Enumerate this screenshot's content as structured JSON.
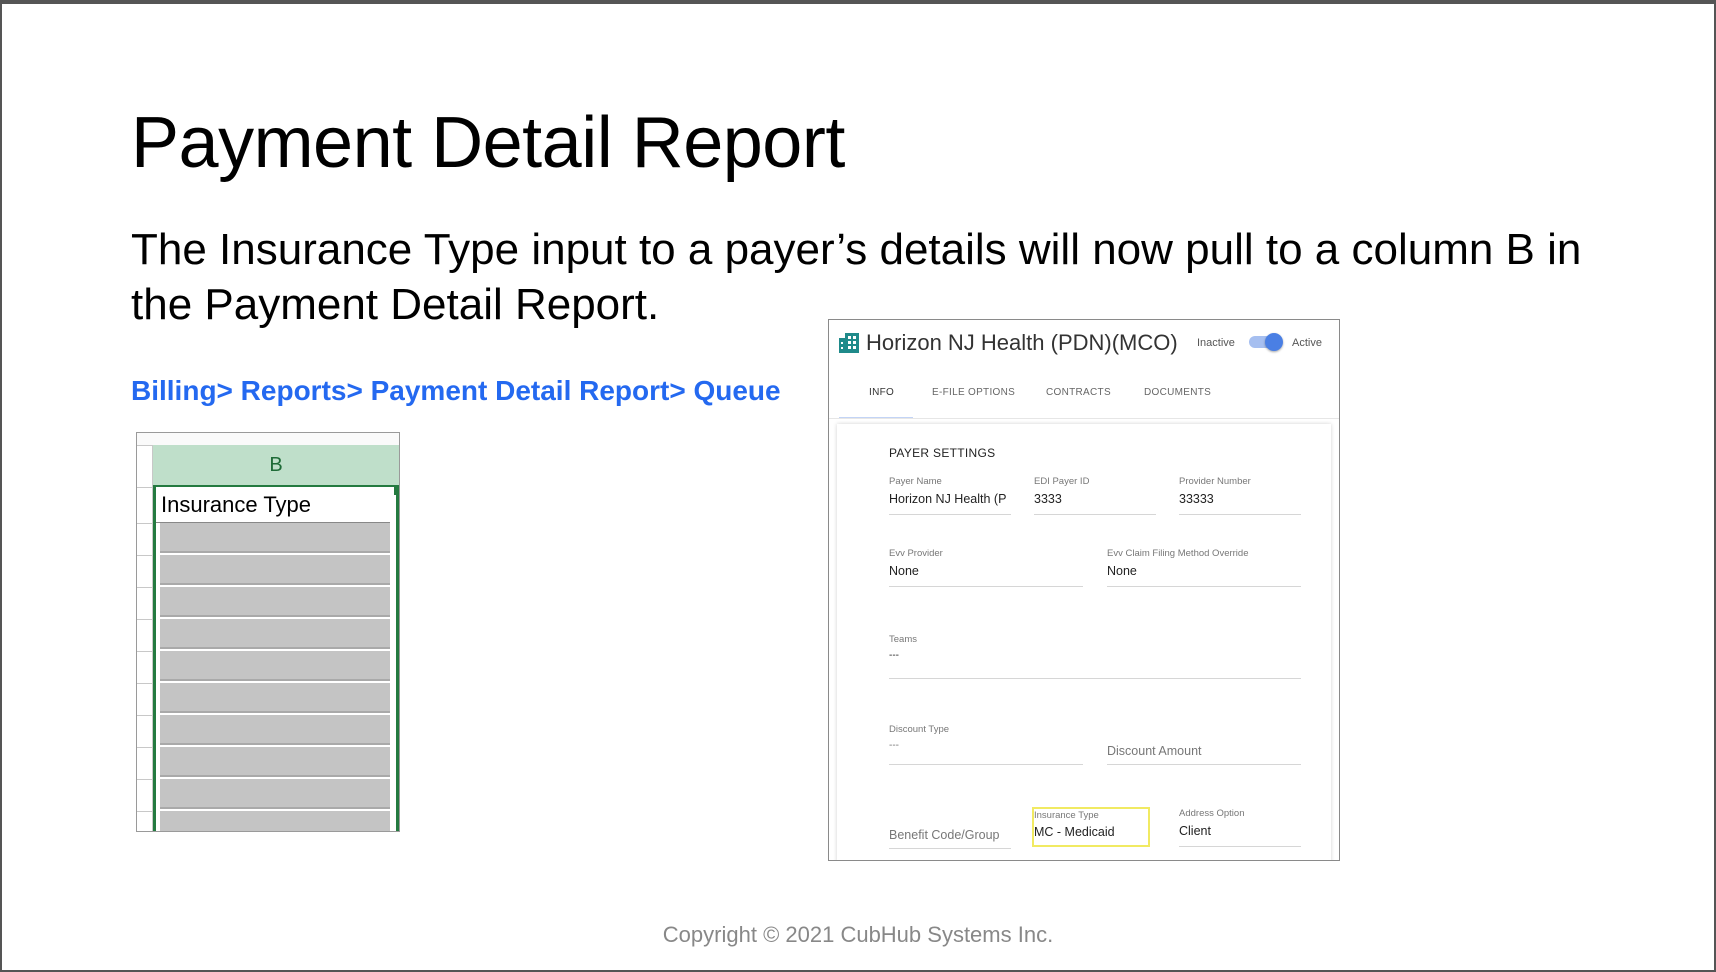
{
  "slide": {
    "title": "Payment Detail Report",
    "body": "The Insurance Type input to a payer’s details will now pull to a column B in the Payment Detail Report.",
    "breadcrumb": "Billing> Reports> Payment Detail Report> Queue",
    "copyright": "Copyright © 2021 CubHub Systems Inc."
  },
  "sheet": {
    "column_header": "B",
    "cell_value": "Insurance Type",
    "header_color": "#bfdfca",
    "border_color": "#247a40"
  },
  "payer": {
    "icon": "building-icon",
    "name": "Horizon NJ Health (PDN)(MCO)",
    "status_inactive": "Inactive",
    "status_active": "Active",
    "toggle_on": true,
    "tabs": [
      {
        "label": "INFO",
        "active": true
      },
      {
        "label": "E-FILE OPTIONS",
        "active": false
      },
      {
        "label": "CONTRACTS",
        "active": false
      },
      {
        "label": "DOCUMENTS",
        "active": false
      }
    ],
    "section_title": "PAYER SETTINGS",
    "fields": {
      "payer_name": {
        "label": "Payer Name",
        "value": "Horizon NJ Health (P"
      },
      "edi_payer_id": {
        "label": "EDI Payer ID",
        "value": "3333"
      },
      "provider_number": {
        "label": "Provider Number",
        "value": "33333"
      },
      "evv_provider": {
        "label": "Evv Provider",
        "value": "None"
      },
      "evv_claim_filing": {
        "label": "Evv Claim Filing Method Override",
        "value": "None"
      },
      "teams": {
        "label": "Teams",
        "value": "---"
      },
      "discount_type": {
        "label": "Discount Type",
        "value": "---"
      },
      "discount_amount": {
        "placeholder": "Discount Amount"
      },
      "benefit_code": {
        "placeholder": "Benefit Code/Group"
      },
      "insurance_type": {
        "label": "Insurance Type",
        "value": "MC - Medicaid"
      },
      "address_option": {
        "label": "Address Option",
        "value": "Client"
      }
    },
    "accent_color": "#4a7fe4",
    "highlight_color": "#f1ea62"
  }
}
